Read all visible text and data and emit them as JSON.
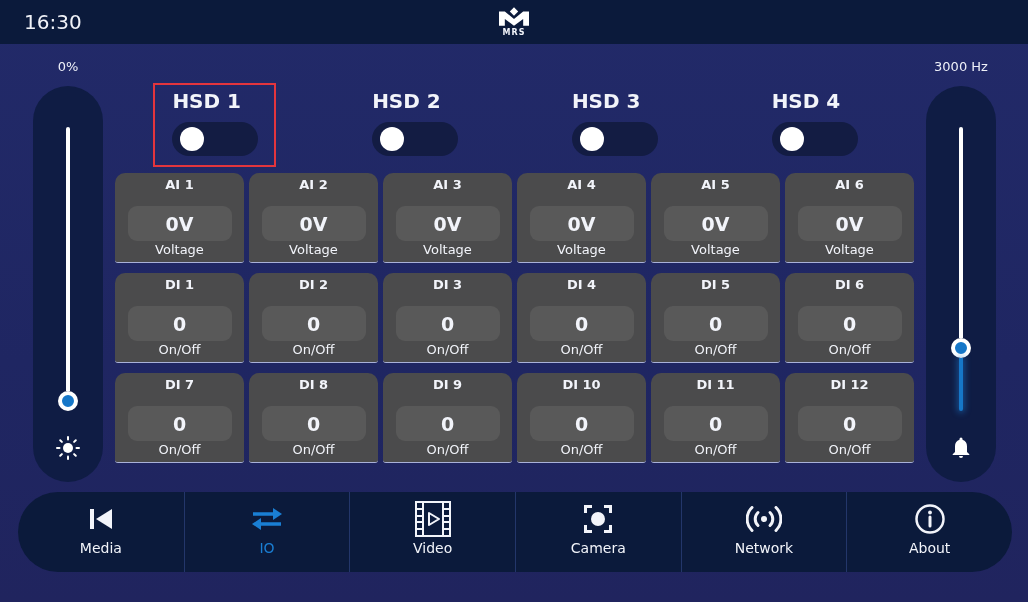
{
  "status_bar": {
    "time": "16:30",
    "logo_text": "MRS"
  },
  "sliders": [
    {
      "kind": "brightness",
      "reading": "0%",
      "level": 0
    },
    {
      "kind": "buzzer",
      "reading": "3000 Hz",
      "level": 0.2
    }
  ],
  "outputs": [
    {
      "label": "HSD 1",
      "on": false,
      "highlighted": true
    },
    {
      "label": "HSD 2",
      "on": false,
      "highlighted": false
    },
    {
      "label": "HSD 3",
      "on": false,
      "highlighted": false
    },
    {
      "label": "HSD 4",
      "on": false,
      "highlighted": false
    }
  ],
  "inputs": [
    {
      "label": "AI 1",
      "value": "0V",
      "caption": "Voltage"
    },
    {
      "label": "AI 2",
      "value": "0V",
      "caption": "Voltage"
    },
    {
      "label": "AI 3",
      "value": "0V",
      "caption": "Voltage"
    },
    {
      "label": "AI 4",
      "value": "0V",
      "caption": "Voltage"
    },
    {
      "label": "AI 5",
      "value": "0V",
      "caption": "Voltage"
    },
    {
      "label": "AI 6",
      "value": "0V",
      "caption": "Voltage"
    },
    {
      "label": "DI 1",
      "value": "0",
      "caption": "On/Off"
    },
    {
      "label": "DI 2",
      "value": "0",
      "caption": "On/Off"
    },
    {
      "label": "DI 3",
      "value": "0",
      "caption": "On/Off"
    },
    {
      "label": "DI 4",
      "value": "0",
      "caption": "On/Off"
    },
    {
      "label": "DI 5",
      "value": "0",
      "caption": "On/Off"
    },
    {
      "label": "DI 6",
      "value": "0",
      "caption": "On/Off"
    },
    {
      "label": "DI 7",
      "value": "0",
      "caption": "On/Off"
    },
    {
      "label": "DI 8",
      "value": "0",
      "caption": "On/Off"
    },
    {
      "label": "DI 9",
      "value": "0",
      "caption": "On/Off"
    },
    {
      "label": "DI 10",
      "value": "0",
      "caption": "On/Off"
    },
    {
      "label": "DI 11",
      "value": "0",
      "caption": "On/Off"
    },
    {
      "label": "DI 12",
      "value": "0",
      "caption": "On/Off"
    }
  ],
  "nav": [
    {
      "kind": "media",
      "label": "Media",
      "selected": false
    },
    {
      "kind": "io",
      "label": "IO",
      "selected": true
    },
    {
      "kind": "video",
      "label": "Video",
      "selected": false
    },
    {
      "kind": "camera",
      "label": "Camera",
      "selected": false
    },
    {
      "kind": "network",
      "label": "Network",
      "selected": false
    },
    {
      "kind": "about",
      "label": "About",
      "selected": false
    }
  ]
}
